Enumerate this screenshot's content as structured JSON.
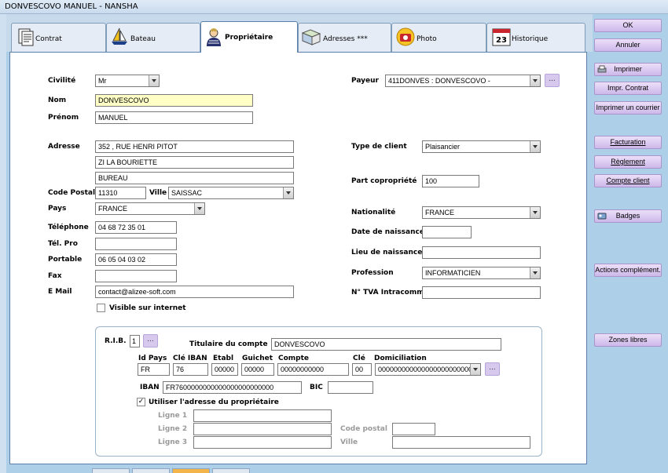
{
  "window": {
    "title": "DONVESCOVO MANUEL - NANSHA"
  },
  "tabs": [
    {
      "label": "Contrat",
      "icon": "document-icon"
    },
    {
      "label": "Bateau",
      "icon": "sailboat-icon"
    },
    {
      "label": "Propriétaire",
      "icon": "person-icon",
      "active": true
    },
    {
      "label": "Adresses ***",
      "icon": "map-icon"
    },
    {
      "label": "Photo",
      "icon": "camera-icon"
    },
    {
      "label": "Historique",
      "icon": "calendar-icon",
      "icon_text": "23"
    }
  ],
  "left": {
    "civilite": {
      "label": "Civilité",
      "value": "Mr"
    },
    "nom": {
      "label": "Nom",
      "value": "DONVESCOVO"
    },
    "prenom": {
      "label": "Prénom",
      "value": "MANUEL"
    },
    "adresse": {
      "label": "Adresse",
      "line1": "352 , RUE HENRI PITOT",
      "line2": "ZI LA BOURIETTE",
      "line3": "BUREAU"
    },
    "code_postal": {
      "label": "Code Postal",
      "value": "11310"
    },
    "ville": {
      "label": "Ville",
      "value": "SAISSAC"
    },
    "pays": {
      "label": "Pays",
      "value": "FRANCE"
    },
    "telephone": {
      "label": "Téléphone",
      "value": "04 68 72 35 01"
    },
    "tel_pro": {
      "label": "Tél. Pro",
      "value": ""
    },
    "portable": {
      "label": "Portable",
      "value": "06 05 04 03 02"
    },
    "fax": {
      "label": "Fax",
      "value": ""
    },
    "email": {
      "label": "E Mail",
      "value": "contact@alizee-soft.com"
    },
    "visible": {
      "label": "Visible sur internet",
      "checked": false
    }
  },
  "right": {
    "payeur": {
      "label": "Payeur",
      "value": "411DONVES : DONVESCOVO -",
      "button": "..."
    },
    "type_client": {
      "label": "Type de client",
      "value": "Plaisancier"
    },
    "part_copro": {
      "label": "Part copropriété",
      "value": "100"
    },
    "nationalite": {
      "label": "Nationalité",
      "value": "FRANCE"
    },
    "date_naissance": {
      "label": "Date de naissance",
      "value": ""
    },
    "lieu_naissance": {
      "label": "Lieu de naissance",
      "value": ""
    },
    "profession": {
      "label": "Profession",
      "value": "INFORMATICIEN"
    },
    "tva": {
      "label": "N° TVA Intracomm",
      "value": ""
    }
  },
  "rib": {
    "label": "R.I.B.",
    "number": "1",
    "button": "...",
    "titulaire": {
      "label": "Titulaire du compte",
      "value": "DONVESCOVO"
    },
    "headers": {
      "id_pays": "Id Pays",
      "cle_iban": "Clé IBAN",
      "etabl": "Etabl",
      "guichet": "Guichet",
      "compte": "Compte",
      "cle": "Clé",
      "domiciliation": "Domiciliation"
    },
    "values": {
      "id_pays": "FR",
      "cle_iban": "76",
      "etabl": "00000",
      "guichet": "00000",
      "compte": "00000000000",
      "cle": "00",
      "domiciliation": "000000000000000000000000000"
    },
    "iban": {
      "label": "IBAN",
      "value": "FR7600000000000000000000000"
    },
    "bic": {
      "label": "BIC",
      "value": ""
    },
    "use_owner_address": {
      "label": "Utiliser l'adresse du propriétaire",
      "checked": true
    },
    "ligne1": {
      "label": "Ligne 1",
      "value": ""
    },
    "ligne2": {
      "label": "Ligne 2",
      "value": ""
    },
    "ligne3": {
      "label": "Ligne 3",
      "value": ""
    },
    "code_postal": {
      "label": "Code postal",
      "value": ""
    },
    "ville": {
      "label": "Ville",
      "value": ""
    }
  },
  "sidebar": {
    "ok": "OK",
    "annuler": "Annuler",
    "imprimer": "Imprimer",
    "impr_contrat": "Impr. Contrat",
    "imprimer_courrier": "Imprimer un courrier",
    "facturation": "Facturation",
    "reglement": "Règlement",
    "compte_client": "Compte client",
    "badges": "Badges",
    "actions": "Actions complément.",
    "zones_libres": "Zones libres"
  },
  "colors": {
    "accent": "#aecfe8",
    "button": "#d7c8ee",
    "highlight_field": "#ffffc6"
  }
}
